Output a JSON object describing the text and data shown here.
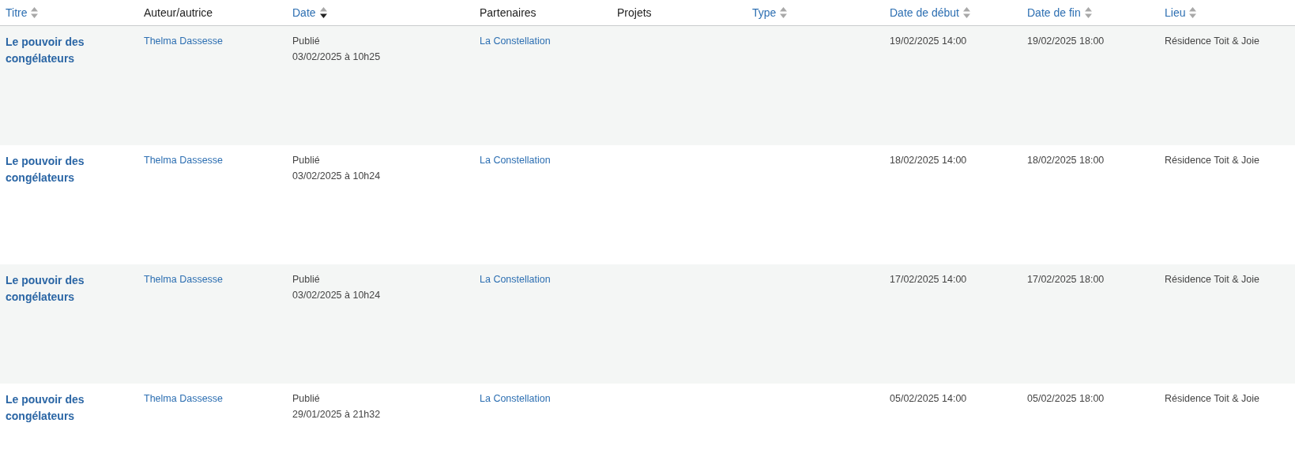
{
  "columns": [
    {
      "label": "Titre",
      "sortable": true,
      "sorted_descending": false
    },
    {
      "label": "Auteur/autrice",
      "sortable": false
    },
    {
      "label": "Date",
      "sortable": true,
      "sorted_descending": true
    },
    {
      "label": "Partenaires",
      "sortable": false
    },
    {
      "label": "Projets",
      "sortable": false
    },
    {
      "label": "Type",
      "sortable": true,
      "sorted_descending": false
    },
    {
      "label": "Date de début",
      "sortable": true,
      "sorted_descending": false
    },
    {
      "label": "Date de fin",
      "sortable": true,
      "sorted_descending": false
    },
    {
      "label": "Lieu",
      "sortable": true,
      "sorted_descending": false
    }
  ],
  "rows": [
    {
      "title": "Le pouvoir des congélateurs",
      "author": "Thelma Dassesse",
      "status": "Publié",
      "published": "03/02/2025 à 10h25",
      "partner": "La Constellation",
      "start": "19/02/2025 14:00",
      "end": "19/02/2025 18:00",
      "place": "Résidence Toit & Joie"
    },
    {
      "title": "Le pouvoir des congélateurs",
      "author": "Thelma Dassesse",
      "status": "Publié",
      "published": "03/02/2025 à 10h24",
      "partner": "La Constellation",
      "start": "18/02/2025 14:00",
      "end": "18/02/2025 18:00",
      "place": "Résidence Toit & Joie"
    },
    {
      "title": "Le pouvoir des congélateurs",
      "author": "Thelma Dassesse",
      "status": "Publié",
      "published": "03/02/2025 à 10h24",
      "partner": "La Constellation",
      "start": "17/02/2025 14:00",
      "end": "17/02/2025 18:00",
      "place": "Résidence Toit & Joie"
    },
    {
      "title": "Le pouvoir des congélateurs",
      "author": "Thelma Dassesse",
      "status": "Publié",
      "published": "29/01/2025 à 21h32",
      "partner": "La Constellation",
      "start": "05/02/2025 14:00",
      "end": "05/02/2025 18:00",
      "place": "Résidence Toit & Joie"
    }
  ]
}
